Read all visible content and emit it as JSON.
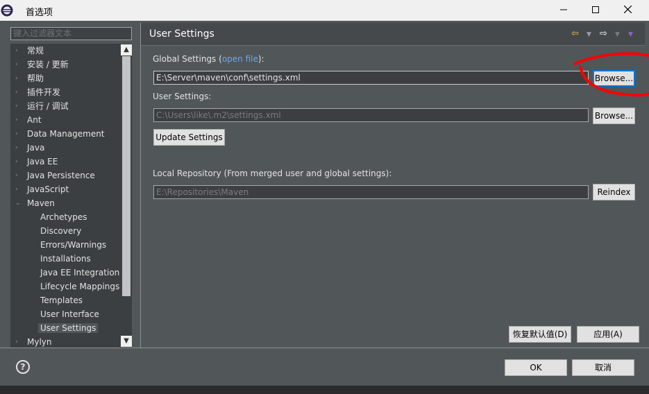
{
  "window": {
    "title": "首选项"
  },
  "titlebar_icons": [
    "eclipse-app-icon",
    "minimize-icon",
    "maximize-icon",
    "close-icon"
  ],
  "filter": {
    "placeholder": "键入过滤器文本"
  },
  "tree": {
    "items": [
      {
        "label": "常规",
        "level": 0,
        "expandable": true
      },
      {
        "label": "安装 / 更新",
        "level": 0,
        "expandable": true
      },
      {
        "label": "帮助",
        "level": 0,
        "expandable": true
      },
      {
        "label": "插件开发",
        "level": 0,
        "expandable": true
      },
      {
        "label": "运行 / 调试",
        "level": 0,
        "expandable": true
      },
      {
        "label": "Ant",
        "level": 0,
        "expandable": true
      },
      {
        "label": "Data Management",
        "level": 0,
        "expandable": true
      },
      {
        "label": "Java",
        "level": 0,
        "expandable": true
      },
      {
        "label": "Java EE",
        "level": 0,
        "expandable": true
      },
      {
        "label": "Java Persistence",
        "level": 0,
        "expandable": true
      },
      {
        "label": "JavaScript",
        "level": 0,
        "expandable": true
      },
      {
        "label": "Maven",
        "level": 0,
        "expandable": true,
        "expanded": true
      },
      {
        "label": "Archetypes",
        "level": 1
      },
      {
        "label": "Discovery",
        "level": 1
      },
      {
        "label": "Errors/Warnings",
        "level": 1
      },
      {
        "label": "Installations",
        "level": 1
      },
      {
        "label": "Java EE Integration",
        "level": 1
      },
      {
        "label": "Lifecycle Mappings",
        "level": 1
      },
      {
        "label": "Templates",
        "level": 1
      },
      {
        "label": "User Interface",
        "level": 1
      },
      {
        "label": "User Settings",
        "level": 1,
        "selected": true
      },
      {
        "label": "Mylyn",
        "level": 0,
        "expandable": true
      }
    ]
  },
  "page": {
    "title": "User Settings",
    "global_label_prefix": "Global Settings (",
    "global_link": "open file",
    "global_label_suffix": "):",
    "global_value": "E:\\Server\\maven\\conf\\settings.xml",
    "browse_label": "Browse...",
    "user_label": "User Settings:",
    "user_value": "C:\\Users\\like\\.m2\\settings.xml",
    "update_label": "Update Settings",
    "local_repo_label": "Local Repository (From merged user and global settings):",
    "local_repo_value": "E:\\Repositories\\Maven",
    "reindex_label": "Reindex",
    "restore_label": "恢复默认值(D)",
    "apply_label": "应用(A)"
  },
  "footer": {
    "ok_label": "OK",
    "cancel_label": "取消"
  },
  "colors": {
    "background": "#515658",
    "tree_bg": "#3b3f41",
    "annotation": "#ff0000",
    "focus": "#0078d7",
    "link": "#6da7e8"
  }
}
